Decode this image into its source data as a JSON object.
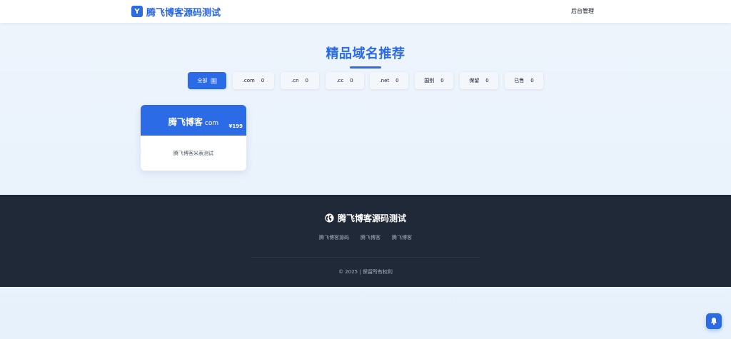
{
  "header": {
    "logo_letter": "Y",
    "site_name": "腾飞博客源码测试",
    "admin_link": "后台管理"
  },
  "section": {
    "title": "精品域名推荐"
  },
  "filters": [
    {
      "label": "全部",
      "count": "1",
      "active": true
    },
    {
      "label": ".com",
      "count": "0",
      "active": false
    },
    {
      "label": ".cn",
      "count": "0",
      "active": false
    },
    {
      "label": ".cc",
      "count": "0",
      "active": false
    },
    {
      "label": ".net",
      "count": "0",
      "active": false
    },
    {
      "label": "国别",
      "count": "0",
      "active": false
    },
    {
      "label": "保留",
      "count": "0",
      "active": false
    },
    {
      "label": "已售",
      "count": "0",
      "active": false
    }
  ],
  "domains": [
    {
      "name": "腾飞博客",
      "suffix": "com",
      "price": "¥199",
      "description": "腾飞博客米表测试"
    }
  ],
  "footer": {
    "title": "腾飞博客源码测试",
    "links": [
      "腾飞博客源码",
      "腾飞博客",
      "腾飞博客"
    ],
    "copyright": "© 2025 | 保留所有权利"
  },
  "icons": {
    "footer_brand": "globe-icon",
    "floating_button": "bell-icon"
  },
  "colors": {
    "accent": "#2b6be6",
    "footer_bg": "#1f2937",
    "page_bg": "#eaf3fc"
  }
}
